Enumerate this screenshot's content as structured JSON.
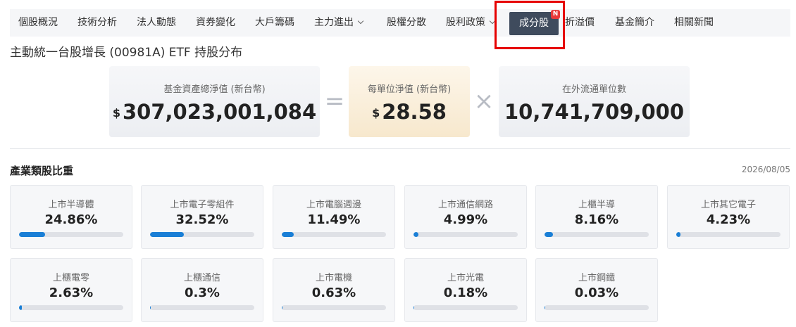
{
  "nav": {
    "items": [
      {
        "label": "個股概況",
        "id": "overview"
      },
      {
        "label": "技術分析",
        "id": "technical"
      },
      {
        "label": "法人動態",
        "id": "institutional"
      },
      {
        "label": "資券變化",
        "id": "margin"
      },
      {
        "label": "大戶籌碼",
        "id": "major-holders"
      },
      {
        "label": "主力進出",
        "id": "main-force",
        "dropdown": true
      },
      {
        "label": "股權分散",
        "id": "distribution"
      },
      {
        "label": "股利政策",
        "id": "dividend",
        "dropdown": true
      },
      {
        "label": "成分股",
        "id": "constituents",
        "active": true,
        "badge": "N"
      },
      {
        "label": "折溢價",
        "id": "premium"
      },
      {
        "label": "基金簡介",
        "id": "fund-intro"
      },
      {
        "label": "相關新聞",
        "id": "news"
      }
    ]
  },
  "page": {
    "title": "主動統一台股增長 (00981A) ETF 持股分布"
  },
  "equation": {
    "total_assets": {
      "label": "基金資產總淨值 (新台幣)",
      "currency": "$",
      "value": "307,023,001,084"
    },
    "equals": "=",
    "nav_per_unit": {
      "label": "每單位淨值 (新台幣)",
      "currency": "$",
      "value": "28.58"
    },
    "times": "×",
    "units_outstanding": {
      "label": "在外流通單位數",
      "value": "10,741,709,000"
    }
  },
  "industry": {
    "title": "產業類股比重",
    "date": "2026/08/05",
    "items": [
      {
        "name": "上市半導體",
        "pct": "24.86%",
        "weight": 24.86
      },
      {
        "name": "上市電子零組件",
        "pct": "32.52%",
        "weight": 32.52
      },
      {
        "name": "上市電腦週邊",
        "pct": "11.49%",
        "weight": 11.49
      },
      {
        "name": "上市通信網路",
        "pct": "4.99%",
        "weight": 4.99
      },
      {
        "name": "上櫃半導",
        "pct": "8.16%",
        "weight": 8.16
      },
      {
        "name": "上市其它電子",
        "pct": "4.23%",
        "weight": 4.23
      },
      {
        "name": "上櫃電零",
        "pct": "2.63%",
        "weight": 2.63
      },
      {
        "name": "上櫃通信",
        "pct": "0.3%",
        "weight": 0.3
      },
      {
        "name": "上市電機",
        "pct": "0.63%",
        "weight": 0.63
      },
      {
        "name": "上市光電",
        "pct": "0.18%",
        "weight": 0.18
      },
      {
        "name": "上市鋼鐵",
        "pct": "0.03%",
        "weight": 0.03
      }
    ]
  },
  "colors": {
    "bar_fill": "#1a7fd6",
    "bar_track": "#dfe1e6",
    "nav_active": "#3f4b5d",
    "badge": "#e83a3a",
    "highlight": "#e60000"
  }
}
